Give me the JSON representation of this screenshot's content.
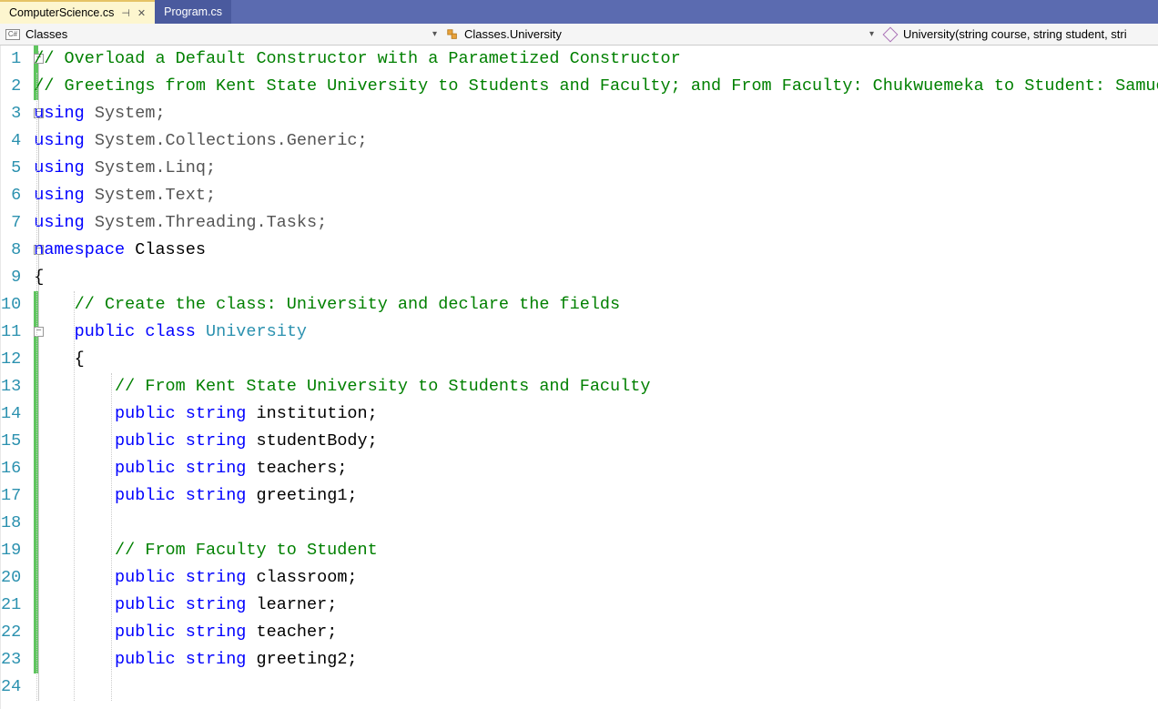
{
  "tabs": [
    {
      "label": "ComputerScience.cs",
      "active": true,
      "pinned": true
    },
    {
      "label": "Program.cs",
      "active": false
    }
  ],
  "nav": {
    "project_icon": "C#",
    "project": "Classes",
    "class": "Classes.University",
    "member": "University(string course, string student, stri"
  },
  "code": {
    "lines": [
      {
        "n": 1,
        "change": true,
        "ind": 0,
        "segs": [
          {
            "t": "// Overload a Default Constructor with a Parametized Constructor",
            "c": "c-comment"
          }
        ]
      },
      {
        "n": 2,
        "change": true,
        "ind": 0,
        "segs": [
          {
            "t": "// Greetings from Kent State University to Students and Faculty; and From Faculty: Chukwuemeka to Student: Samuel",
            "c": "c-comment"
          }
        ]
      },
      {
        "n": 3,
        "change": false,
        "ind": 0,
        "segs": [
          {
            "t": "using",
            "c": "c-key"
          },
          {
            "t": " System;",
            "c": "c-ns"
          }
        ]
      },
      {
        "n": 4,
        "change": false,
        "ind": 0,
        "segs": [
          {
            "t": "using",
            "c": "c-key"
          },
          {
            "t": " System.Collections.Generic;",
            "c": "c-ns"
          }
        ]
      },
      {
        "n": 5,
        "change": false,
        "ind": 0,
        "segs": [
          {
            "t": "using",
            "c": "c-key"
          },
          {
            "t": " System.Linq;",
            "c": "c-ns"
          }
        ]
      },
      {
        "n": 6,
        "change": false,
        "ind": 0,
        "segs": [
          {
            "t": "using",
            "c": "c-key"
          },
          {
            "t": " System.Text;",
            "c": "c-ns"
          }
        ]
      },
      {
        "n": 7,
        "change": false,
        "ind": 0,
        "segs": [
          {
            "t": "using",
            "c": "c-key"
          },
          {
            "t": " System.Threading.Tasks;",
            "c": "c-ns"
          }
        ]
      },
      {
        "n": 8,
        "change": false,
        "ind": 0,
        "segs": [
          {
            "t": "namespace",
            "c": "c-key"
          },
          {
            "t": " Classes",
            "c": "c-txt"
          }
        ]
      },
      {
        "n": 9,
        "change": false,
        "ind": 0,
        "segs": [
          {
            "t": "{",
            "c": "c-txt"
          }
        ]
      },
      {
        "n": 10,
        "change": true,
        "ind": 1,
        "segs": [
          {
            "t": "// Create the class: University and declare the fields",
            "c": "c-comment"
          }
        ]
      },
      {
        "n": 11,
        "change": true,
        "ind": 1,
        "segs": [
          {
            "t": "public",
            "c": "c-key"
          },
          {
            "t": " ",
            "c": "c-txt"
          },
          {
            "t": "class",
            "c": "c-key"
          },
          {
            "t": " ",
            "c": "c-txt"
          },
          {
            "t": "University",
            "c": "c-type"
          }
        ]
      },
      {
        "n": 12,
        "change": true,
        "ind": 1,
        "segs": [
          {
            "t": "{",
            "c": "c-txt"
          }
        ]
      },
      {
        "n": 13,
        "change": true,
        "ind": 2,
        "segs": [
          {
            "t": "// From Kent State University to Students and Faculty",
            "c": "c-comment"
          }
        ]
      },
      {
        "n": 14,
        "change": true,
        "ind": 2,
        "segs": [
          {
            "t": "public",
            "c": "c-key"
          },
          {
            "t": " ",
            "c": "c-txt"
          },
          {
            "t": "string",
            "c": "c-key"
          },
          {
            "t": " institution;",
            "c": "c-txt"
          }
        ]
      },
      {
        "n": 15,
        "change": true,
        "ind": 2,
        "segs": [
          {
            "t": "public",
            "c": "c-key"
          },
          {
            "t": " ",
            "c": "c-txt"
          },
          {
            "t": "string",
            "c": "c-key"
          },
          {
            "t": " studentBody;",
            "c": "c-txt"
          }
        ]
      },
      {
        "n": 16,
        "change": true,
        "ind": 2,
        "segs": [
          {
            "t": "public",
            "c": "c-key"
          },
          {
            "t": " ",
            "c": "c-txt"
          },
          {
            "t": "string",
            "c": "c-key"
          },
          {
            "t": " teachers;",
            "c": "c-txt"
          }
        ]
      },
      {
        "n": 17,
        "change": true,
        "ind": 2,
        "segs": [
          {
            "t": "public",
            "c": "c-key"
          },
          {
            "t": " ",
            "c": "c-txt"
          },
          {
            "t": "string",
            "c": "c-key"
          },
          {
            "t": " greeting1;",
            "c": "c-txt"
          }
        ]
      },
      {
        "n": 18,
        "change": true,
        "ind": 2,
        "segs": []
      },
      {
        "n": 19,
        "change": true,
        "ind": 2,
        "segs": [
          {
            "t": "// From Faculty to Student",
            "c": "c-comment"
          }
        ]
      },
      {
        "n": 20,
        "change": true,
        "ind": 2,
        "segs": [
          {
            "t": "public",
            "c": "c-key"
          },
          {
            "t": " ",
            "c": "c-txt"
          },
          {
            "t": "string",
            "c": "c-key"
          },
          {
            "t": " classroom;",
            "c": "c-txt"
          }
        ]
      },
      {
        "n": 21,
        "change": true,
        "ind": 2,
        "segs": [
          {
            "t": "public",
            "c": "c-key"
          },
          {
            "t": " ",
            "c": "c-txt"
          },
          {
            "t": "string",
            "c": "c-key"
          },
          {
            "t": " learner;",
            "c": "c-txt"
          }
        ]
      },
      {
        "n": 22,
        "change": true,
        "ind": 2,
        "segs": [
          {
            "t": "public",
            "c": "c-key"
          },
          {
            "t": " ",
            "c": "c-txt"
          },
          {
            "t": "string",
            "c": "c-key"
          },
          {
            "t": " teacher;",
            "c": "c-txt"
          }
        ]
      },
      {
        "n": 23,
        "change": true,
        "ind": 2,
        "segs": [
          {
            "t": "public",
            "c": "c-key"
          },
          {
            "t": " ",
            "c": "c-txt"
          },
          {
            "t": "string",
            "c": "c-key"
          },
          {
            "t": " greeting2;",
            "c": "c-txt"
          }
        ]
      },
      {
        "n": 24,
        "change": false,
        "ind": 2,
        "segs": []
      }
    ],
    "fold_boxes": [
      1,
      3,
      8,
      11
    ]
  }
}
